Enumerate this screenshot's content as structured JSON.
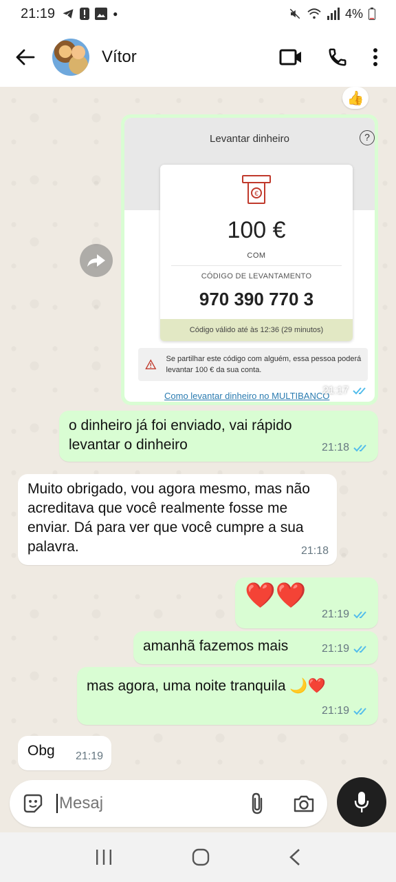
{
  "status_bar": {
    "time": "21:19",
    "battery": "4%"
  },
  "header": {
    "contact_name": "Vítor"
  },
  "image_message": {
    "title": "Levantar dinheiro",
    "help_symbol": "?",
    "amount": "100 €",
    "provider": "COM",
    "code_label": "CÓDIGO DE LEVANTAMENTO",
    "code_value": "970 390 770 3",
    "validity": "Código válido até às 12:36 (29 minutos)",
    "warning": "Se partilhar este código com alguém, essa pessoa poderá levantar 100 € da sua conta.",
    "help_link": "Como levantar dinheiro no MULTIBANCO",
    "time": "21:17"
  },
  "reaction": "👍",
  "messages": [
    {
      "text": "o dinheiro já foi enviado, vai rápido levantar o dinheiro",
      "time": "21:18"
    },
    {
      "text": "Muito obrigado, vou agora mesmo, mas não acreditava que você realmente fosse me enviar. Dá para ver que você cumpre a sua palavra.",
      "time": "21:18"
    },
    {
      "text": "❤️❤️",
      "time": "21:19"
    },
    {
      "text": "amanhã fazemos mais",
      "time": "21:19"
    },
    {
      "text": "mas agora, uma noite tranquila 🌙❤️",
      "time": "21:19"
    },
    {
      "text": "Obg",
      "time": "21:19"
    }
  ],
  "composer": {
    "placeholder": "Mesaj"
  },
  "colors": {
    "outgoing": "#d9fdd3",
    "incoming": "#ffffff",
    "read_ticks": "#53bdeb",
    "chat_bg": "#efeae2"
  }
}
